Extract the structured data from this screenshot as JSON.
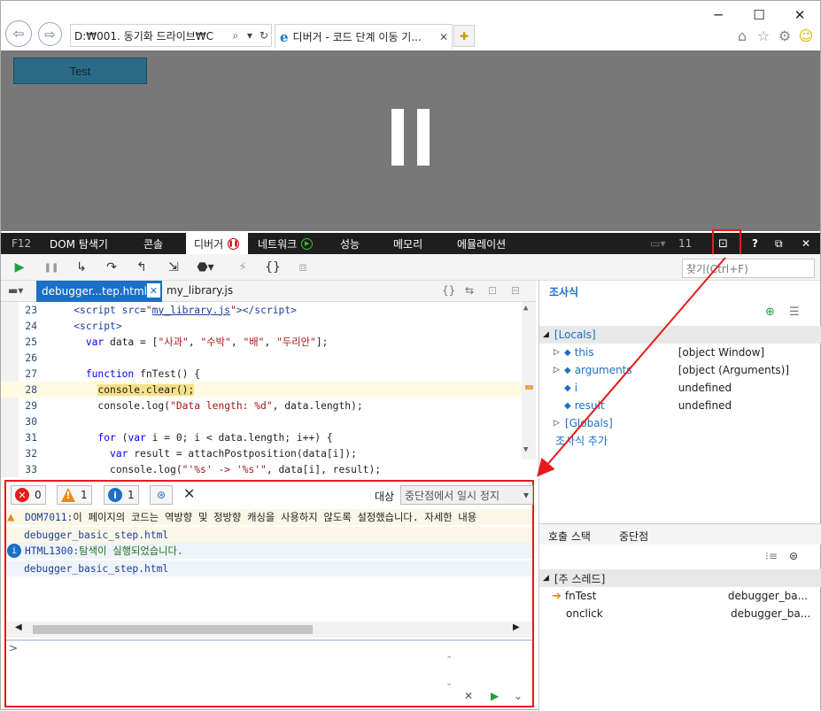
{
  "window": {
    "minimize": "─",
    "maximize": "☐",
    "close": "✕"
  },
  "browser": {
    "address": "D:₩001. 동기화 드라이브₩C",
    "tab_title": "디버거 - 코드 단계 이동 기..."
  },
  "page": {
    "test_button": "Test"
  },
  "devtools": {
    "tabs": [
      "F12",
      "DOM 탐색기",
      "콘솔",
      "디버거",
      "네트워크",
      "성능",
      "메모리",
      "에뮬레이션"
    ],
    "active_tab": "디버거",
    "error_count": "11",
    "help": "?",
    "find_placeholder": "찾기(Ctrl+F)"
  },
  "files": {
    "open": [
      "debugger...tep.html",
      "my_library.js"
    ]
  },
  "code": [
    {
      "n": "23",
      "html": "<span class='tag'>&lt;script</span> <span class='tag'>src</span>=<span class='str'>\"</span><span class='lnk'>my_library.js</span><span class='str'>\"</span><span class='tag'>&gt;&lt;/script&gt;</span>",
      "indent": "    "
    },
    {
      "n": "24",
      "html": "<span class='tag'>&lt;script&gt;</span>",
      "indent": "    "
    },
    {
      "n": "25",
      "html": "<span class='kw'>var</span> data = [<span class='str'>\"사과\"</span>, <span class='str'>\"수박\"</span>, <span class='str'>\"배\"</span>, <span class='str'>\"두리안\"</span>];",
      "indent": "      "
    },
    {
      "n": "26",
      "html": "",
      "indent": ""
    },
    {
      "n": "27",
      "html": "<span class='kw'>function</span> fnTest() {",
      "indent": "      "
    },
    {
      "n": "28",
      "html": "<span style='background:#f6e08a'>console.clear();</span>",
      "indent": "        "
    },
    {
      "n": "29",
      "html": "console.log(<span class='str'>\"Data length: %d\"</span>, data.length);",
      "indent": "        "
    },
    {
      "n": "30",
      "html": "",
      "indent": ""
    },
    {
      "n": "31",
      "html": "<span class='kw'>for</span> (<span class='kw'>var</span> i = 0; i &lt; data.length; i++) {",
      "indent": "        "
    },
    {
      "n": "32",
      "html": "<span class='kw'>var</span> result = attachPostposition(data[i]);",
      "indent": "          "
    },
    {
      "n": "33",
      "html": "console.log(<span class='str'>\"'%s' -&gt; '%s'\"</span>, data[i], result);",
      "indent": "          "
    }
  ],
  "watch": {
    "title": "조사식",
    "locals_label": "[Locals]",
    "vars": [
      {
        "name": "this",
        "value": "[object Window]"
      },
      {
        "name": "arguments",
        "value": "[object (Arguments)]"
      },
      {
        "name": "i",
        "value": "undefined"
      },
      {
        "name": "result",
        "value": "undefined"
      }
    ],
    "globals_label": "[Globals]",
    "add_label": "조사식 추가"
  },
  "callstack": {
    "tab1": "호출 스택",
    "tab2": "중단점",
    "thread": "[주 스레드]",
    "frames": [
      {
        "name": "fnTest",
        "loc": "debugger_ba..."
      },
      {
        "name": "onclick",
        "loc": "debugger_ba..."
      }
    ]
  },
  "console": {
    "errors": "0",
    "warnings": "1",
    "infos": "1",
    "target_label": "대상",
    "target_value": "중단점에서 일시 정지",
    "messages": [
      {
        "code": "DOM7011:",
        "text": " 이 페이지의 코드는 역방향 및 정방향 캐싱을 사용하지 않도록 설정했습니다. 자세한 내용",
        "file": "debugger_basic_step.html"
      },
      {
        "code": "HTML1300:",
        "text": " 탐색이 실행되었습니다.",
        "file": "debugger_basic_step.html"
      }
    ],
    "prompt": ">"
  }
}
